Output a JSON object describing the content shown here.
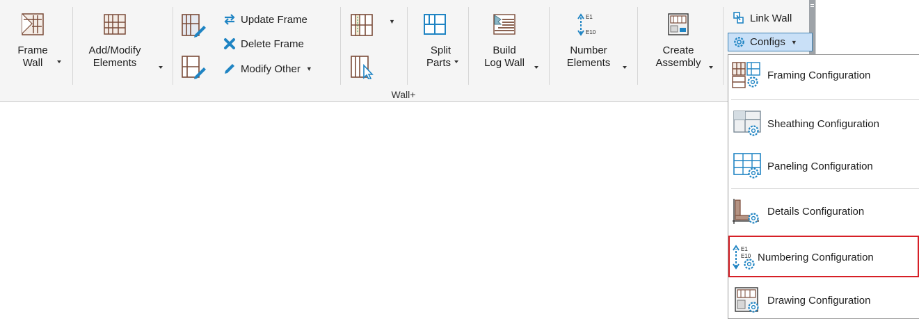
{
  "ribbon": {
    "panel_label": "Wall+",
    "buttons": {
      "frame_wall": {
        "line1": "Frame",
        "line2": "Wall"
      },
      "add_modify": {
        "line1": "Add/Modify",
        "line2": "Elements"
      },
      "update_frame": "Update Frame",
      "delete_frame": "Delete Frame",
      "modify_other": "Modify Other",
      "split_parts": {
        "line1": "Split",
        "line2": "Parts"
      },
      "build_log_wall": {
        "line1": "Build",
        "line2": "Log Wall"
      },
      "number_elements": {
        "line1": "Number",
        "line2": "Elements"
      },
      "create_assembly": {
        "line1": "Create",
        "line2": "Assembly"
      },
      "link_wall": "Link Wall",
      "configs": "Configs"
    },
    "number_icon": {
      "top": "E1",
      "bottom": "E10"
    }
  },
  "configs_menu": {
    "items": [
      {
        "label": "Framing Configuration",
        "icon": "framing-config-icon"
      },
      {
        "label": "Sheathing Configuration",
        "icon": "sheathing-config-icon"
      },
      {
        "label": "Paneling Configuration",
        "icon": "paneling-config-icon"
      },
      {
        "label": "Details Configuration",
        "icon": "details-config-icon"
      },
      {
        "label": "Numbering Configuration",
        "icon": "numbering-config-icon",
        "highlighted": true
      },
      {
        "label": "Drawing Configuration",
        "icon": "drawing-config-icon"
      }
    ]
  },
  "colors": {
    "accent_blue": "#1f84c3",
    "frame_brown": "#8a5a44",
    "highlight_red": "#d61f26"
  }
}
